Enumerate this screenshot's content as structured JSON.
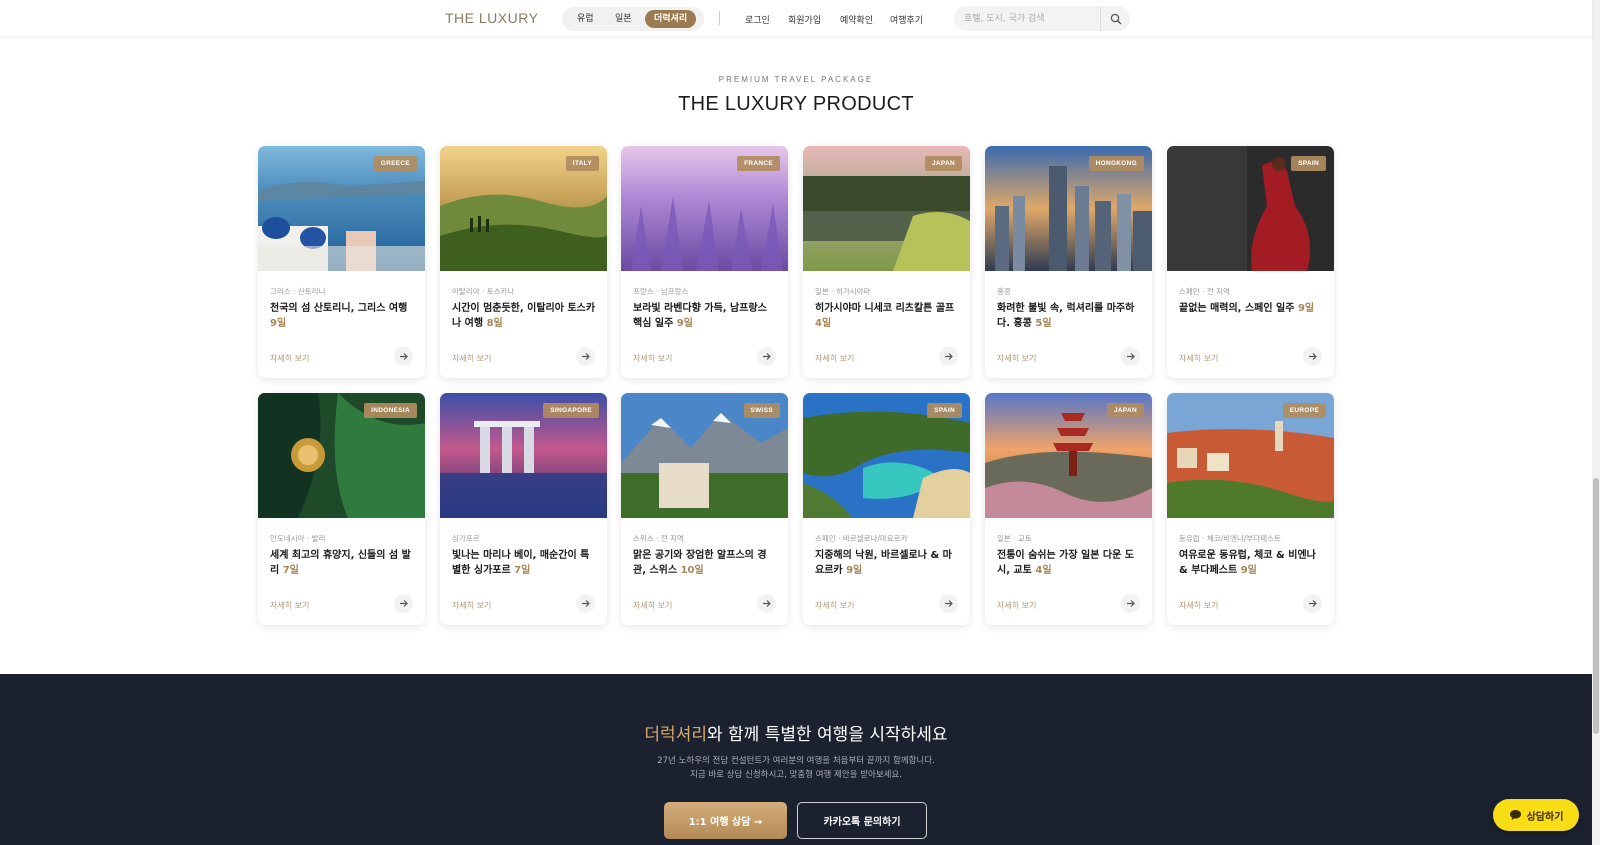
{
  "header": {
    "logo": "THE LUXURY",
    "pill_tabs": [
      {
        "label": "유럽"
      },
      {
        "label": "일본"
      },
      {
        "label": "더럭셔리"
      }
    ],
    "nav": [
      {
        "label": "로그인"
      },
      {
        "label": "회원가입"
      },
      {
        "label": "예약확인"
      },
      {
        "label": "여행후기"
      }
    ],
    "search": {
      "placeholder": "호텔, 도시, 국가 검색",
      "icon": "search-icon"
    }
  },
  "section": {
    "eyebrow": "PREMIUM TRAVEL PACKAGE",
    "title": "THE LUXURY PRODUCT"
  },
  "products": [
    {
      "badge": "GREECE",
      "location": "그리스 · 산토리니",
      "title": "천국의 섬 산토리니, 그리스 여행 ",
      "days": "9일",
      "more": "자세히 보기"
    },
    {
      "badge": "ITALY",
      "location": "이탈리아 · 토스카나",
      "title": "시간이 멈춘듯한, 이탈리아 토스카나 여행 ",
      "days": "8일",
      "more": "자세히 보기"
    },
    {
      "badge": "FRANCE",
      "location": "프랑스 · 남프랑스",
      "title": "보라빛 라벤다향 가득, 남프랑스 핵심 일주 ",
      "days": "9일",
      "more": "자세히 보기"
    },
    {
      "badge": "JAPAN",
      "location": "일본 · 히가시야마",
      "title": "히가시야마 니세코 리츠칼튼 골프 ",
      "days": "4일",
      "more": "자세히 보기"
    },
    {
      "badge": "HONGKONG",
      "location": "홍콩",
      "title": "화려한 불빛 속, 럭셔리를 마주하다. 홍콩 ",
      "days": "5일",
      "more": "자세히 보기"
    },
    {
      "badge": "SPAIN",
      "location": "스페인 · 전 지역",
      "title": "끝없는 매력의, 스페인 일주 ",
      "days": "9일",
      "more": "자세히 보기"
    },
    {
      "badge": "INDONESIA",
      "location": "인도네시아 · 발리",
      "title": "세계 최고의 휴양지, 신들의 섬 발리 ",
      "days": "7일",
      "more": "자세히 보기"
    },
    {
      "badge": "SINGAPORE",
      "location": "싱가포르",
      "title": "빛나는 마리나 베이, 매순간이 특별한 싱가포르 ",
      "days": "7일",
      "more": "자세히 보기"
    },
    {
      "badge": "SWISS",
      "location": "스위스 · 전 지역",
      "title": "맑은 공기와 장엄한 알프스의 경관, 스위스 ",
      "days": "10일",
      "more": "자세히 보기"
    },
    {
      "badge": "SPAIN",
      "location": "스페인 · 바르셀로나/마요르카",
      "title": "지중해의 낙원, 바르셀로나 & 마요르카 ",
      "days": "9일",
      "more": "자세히 보기"
    },
    {
      "badge": "JAPAN",
      "location": "일본 · 교토",
      "title": "전통이 숨쉬는 가장 일본 다운 도시, 교토 ",
      "days": "4일",
      "more": "자세히 보기"
    },
    {
      "badge": "EUROPE",
      "location": "동유럽 · 체코/비엔나/부다페스트",
      "title": "여유로운 동유럽, 체코 & 비엔나 & 부다페스트 ",
      "days": "9일",
      "more": "자세히 보기"
    }
  ],
  "cta": {
    "title_accent": "더럭셔리",
    "title_rest": "와 함께 특별한 여행을 시작하세요",
    "desc_line1": "27년 노하우의 전담 컨설턴트가 여러분의 여행을 처음부터 끝까지 함께합니다.",
    "desc_line2": "지금 바로 상담 신청하시고, 맞춤형 여행 제안을 받아보세요.",
    "primary_label": "1:1 여행 상담 →",
    "secondary_label": "카카오톡 문의하기"
  },
  "chat": {
    "label": "상담하기",
    "icon": "chat-bubble-icon"
  },
  "colors": {
    "accent": "#b08c60",
    "dark": "#1c2130",
    "kakao": "#f9dd16"
  }
}
